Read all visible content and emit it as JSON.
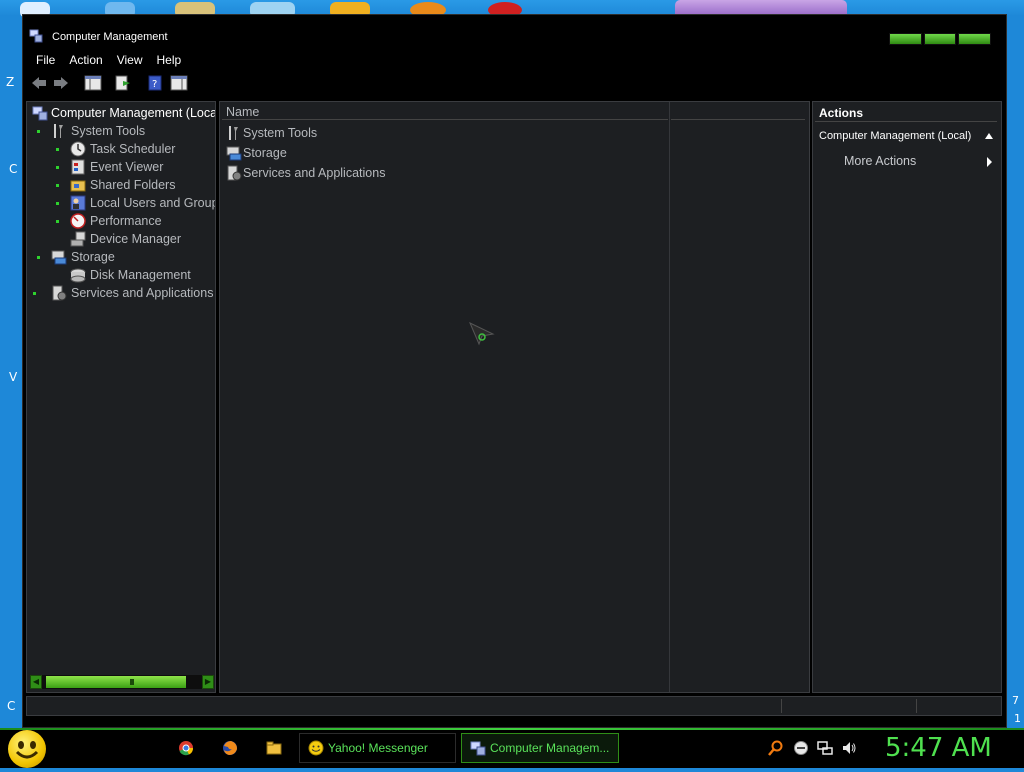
{
  "window": {
    "title": "Computer Management",
    "menu": [
      "File",
      "Action",
      "View",
      "Help"
    ]
  },
  "tree": {
    "root": "Computer Management (Local)",
    "items": [
      {
        "label": "System Tools",
        "level": 1,
        "icon": "tools-icon"
      },
      {
        "label": "Task Scheduler",
        "level": 2,
        "icon": "clock-icon"
      },
      {
        "label": "Event Viewer",
        "level": 2,
        "icon": "event-viewer-icon"
      },
      {
        "label": "Shared Folders",
        "level": 2,
        "icon": "shared-folders-icon"
      },
      {
        "label": "Local Users and Groups",
        "level": 2,
        "icon": "users-icon"
      },
      {
        "label": "Performance",
        "level": 2,
        "icon": "performance-icon"
      },
      {
        "label": "Device Manager",
        "level": 2,
        "icon": "device-manager-icon"
      },
      {
        "label": "Storage",
        "level": 1,
        "icon": "storage-icon"
      },
      {
        "label": "Disk Management",
        "level": 2,
        "icon": "disk-icon"
      },
      {
        "label": "Services and Applications",
        "level": 1,
        "icon": "services-icon"
      }
    ]
  },
  "list": {
    "column_name": "Name",
    "items": [
      "System Tools",
      "Storage",
      "Services and Applications"
    ]
  },
  "actions": {
    "header": "Actions",
    "section": "Computer Management (Local)",
    "more": "More Actions"
  },
  "taskbar": {
    "buttons": [
      "Yahoo! Messenger",
      "Computer Managem..."
    ],
    "clock": "5:47 AM"
  },
  "colors": {
    "accent_green": "#4fe04f",
    "pane_bg": "#1d1f22",
    "desktop_blue": "#1e88d8"
  }
}
